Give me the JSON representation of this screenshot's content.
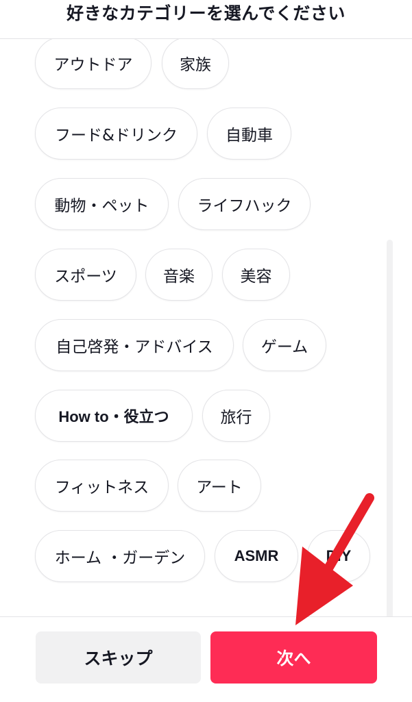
{
  "header": {
    "title": "好きなカテゴリーを選んでください"
  },
  "categories": [
    "アウトドア",
    "家族",
    "フード&ドリンク",
    "自動車",
    "動物・ペット",
    "ライフハック",
    "スポーツ",
    "音楽",
    "美容",
    "自己啓発・アドバイス",
    "ゲーム",
    "How to・役立つ",
    "旅行",
    "フィットネス",
    "アート",
    "ホーム ・ガーデン",
    "ASMR",
    "DIY"
  ],
  "footer": {
    "skip_label": "スキップ",
    "next_label": "次へ"
  },
  "colors": {
    "accent": "#fe2c55",
    "annotation_arrow": "#e8202a",
    "chip_border": "#e3e3e6",
    "secondary_button": "#f1f1f2"
  }
}
